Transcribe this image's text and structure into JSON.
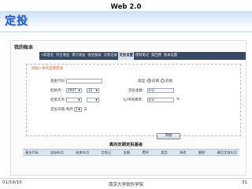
{
  "slide": {
    "top_title": "Web 2.0",
    "heading": "定投",
    "footer": {
      "date": "01/19/10",
      "center": "南京大学软件学院",
      "page": "31"
    }
  },
  "app": {
    "account_title": "我的账本",
    "nav": [
      {
        "label": "+新基金",
        "active": false
      },
      {
        "label": "持仓收益",
        "active": false
      },
      {
        "label": "累计收益",
        "active": false
      },
      {
        "label": "收益报表",
        "active": false
      },
      {
        "label": "交易记录",
        "active": false
      },
      {
        "label": "定投设置",
        "active": true
      },
      {
        "label": "理财笔记",
        "active": false
      },
      {
        "label": "赎回费",
        "active": false
      },
      {
        "label": "账本设置",
        "active": false
      }
    ],
    "form": {
      "legend": "添加一条的定期定投",
      "fund_code_label": "基金代码：",
      "fund_code_value": "",
      "start_date_label": "起始月：",
      "start_year": "2007",
      "start_month": "12",
      "end_date_label": "结束年月：",
      "end_year": "",
      "end_month": "",
      "invest_date_label": "定投日期：",
      "invest_date_prefix": "每月",
      "invest_date_value": "1",
      "invest_date_suffix": "日",
      "type_label": "类型：",
      "type_option_1": "前端",
      "type_option_2": "后端",
      "amount_label": "定投金额：",
      "amount_value": "0.0",
      "rate_label": "认/申购费率：",
      "rate_value": "0.0",
      "rate_unit": "%",
      "add_button": "添加"
    },
    "table": {
      "title": "真的定期定投基金",
      "columns": [
        "基金代码",
        "起始年月",
        "结束年月",
        "定投日",
        "金额",
        "费率",
        "类型",
        "修改",
        "删除",
        "最后定投年月"
      ]
    }
  }
}
